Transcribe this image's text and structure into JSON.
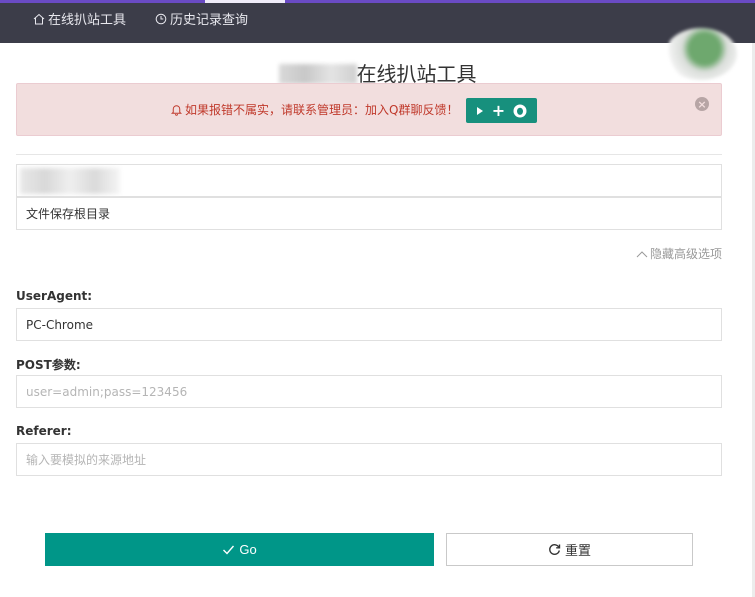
{
  "nav": {
    "home_label": "在线扒站工具",
    "history_label": "历史记录查询"
  },
  "page": {
    "title": "在线扒站工具"
  },
  "alert": {
    "message": "如果报错不属实，请联系管理员：加入Q群聊反馈！",
    "button_label": "+"
  },
  "form": {
    "url_value": "",
    "save_dir_value": "文件保存根目录",
    "advanced_toggle_label": "隐藏高级选项",
    "useragent_label": "UserAgent:",
    "useragent_value": "PC-Chrome",
    "post_label": "POST参数:",
    "post_placeholder": "user=admin;pass=123456",
    "referer_label": "Referer:",
    "referer_placeholder": "输入要模拟的来源地址"
  },
  "buttons": {
    "go_label": "Go",
    "reset_label": "重置"
  },
  "colors": {
    "topbar": "#3c3d49",
    "primary": "#009688",
    "alert_bg": "#f2dede",
    "alert_text": "#c0392b"
  }
}
